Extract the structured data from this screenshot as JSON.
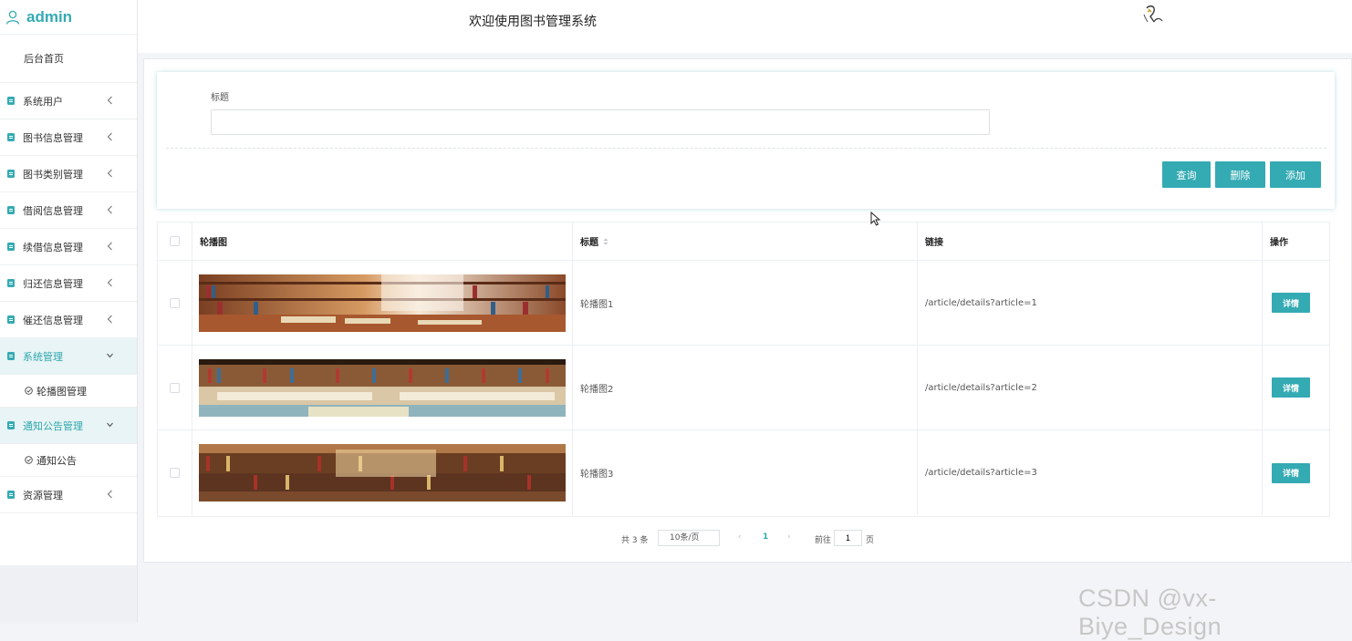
{
  "header": {
    "title": "欢迎使用图书管理系统"
  },
  "sidebar": {
    "user": "admin",
    "home": "后台首页",
    "items": [
      {
        "label": "系统用户",
        "open": false
      },
      {
        "label": "图书信息管理",
        "open": false
      },
      {
        "label": "图书类别管理",
        "open": false
      },
      {
        "label": "借阅信息管理",
        "open": false
      },
      {
        "label": "续借信息管理",
        "open": false
      },
      {
        "label": "归还信息管理",
        "open": false
      },
      {
        "label": "催还信息管理",
        "open": false
      },
      {
        "label": "系统管理",
        "open": true,
        "sub": "轮播图管理"
      },
      {
        "label": "通知公告管理",
        "open": true,
        "sub": "通知公告"
      },
      {
        "label": "资源管理",
        "open": false
      }
    ]
  },
  "search": {
    "label": "标题",
    "value": "",
    "query_btn": "查询",
    "delete_btn": "删除",
    "add_btn": "添加"
  },
  "table": {
    "headers": {
      "image": "轮播图",
      "title": "标题",
      "link": "链接",
      "action": "操作"
    },
    "rows": [
      {
        "title": "轮播图1",
        "link": "/article/details?article=1",
        "action": "详情"
      },
      {
        "title": "轮播图2",
        "link": "/article/details?article=2",
        "action": "详情"
      },
      {
        "title": "轮播图3",
        "link": "/article/details?article=3",
        "action": "详情"
      }
    ]
  },
  "pager": {
    "total": "共 3 条",
    "size": "10条/页",
    "page": "1",
    "goto": "前往",
    "goto_value": "1",
    "unit": "页"
  },
  "watermark": "CSDN @vx-Biye_Design",
  "colors": {
    "accent": "#34aab3",
    "sidebar_open_bg": "#e8f4f5"
  }
}
